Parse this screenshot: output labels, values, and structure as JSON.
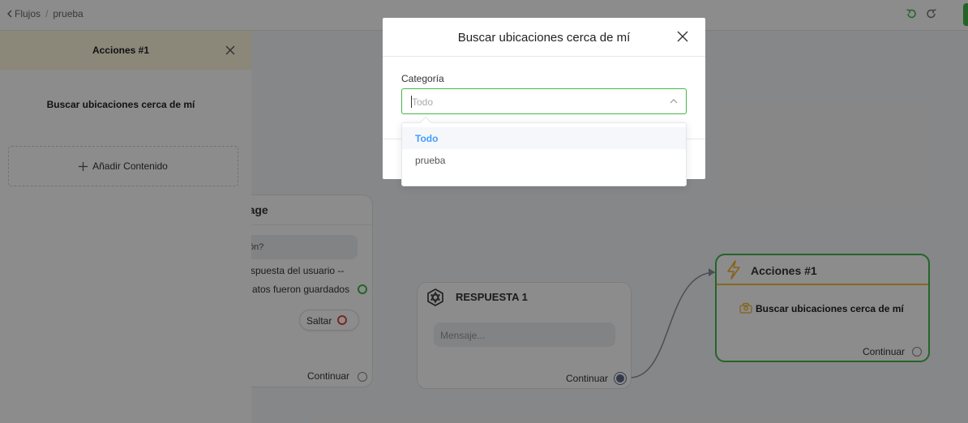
{
  "breadcrumb": {
    "root": "Flujos",
    "separator": "/",
    "current": "prueba"
  },
  "colors": {
    "accent": "#43b649",
    "warning": "#f0c238",
    "link": "#409eff",
    "danger": "#e04646"
  },
  "nodes": {
    "message": {
      "title_partial": "ssage",
      "question_partial": "ción?",
      "line1": "spuesta del usuario --",
      "line2": "atos fueron guardados",
      "skip_label": "Saltar",
      "continue_label": "Continuar"
    },
    "respuesta": {
      "title": "RESPUESTA 1",
      "message_placeholder": "Mensaje...",
      "continue_label": "Continuar"
    },
    "acciones": {
      "title": "Acciones #1",
      "action": "Buscar ubicaciones cerca de mí",
      "continue_label": "Continuar"
    }
  },
  "side_panel": {
    "title": "Acciones #1",
    "subtitle": "Buscar ubicaciones cerca de mí",
    "add_content_label": "Añadir Contenido"
  },
  "modal": {
    "title": "Buscar ubicaciones cerca de mí",
    "field_label": "Categoría",
    "select_placeholder": "Todo",
    "options": [
      {
        "label": "Todo",
        "selected": true
      },
      {
        "label": "prueba",
        "selected": false
      }
    ]
  }
}
